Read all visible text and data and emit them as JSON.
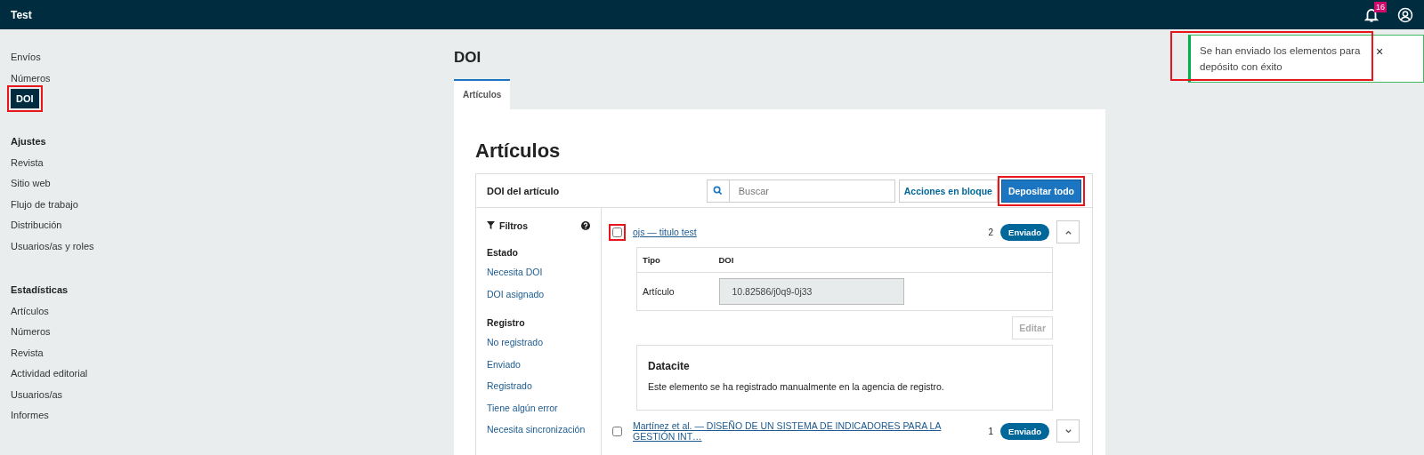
{
  "header": {
    "title": "Test",
    "notifications": "16"
  },
  "toast": {
    "message": "Se han enviado los elementos para depósito con éxito",
    "close": "×",
    "highlighted": true
  },
  "sidebar": {
    "groups": [
      {
        "items": [
          {
            "label": "Envíos",
            "selected": false,
            "highlighted": false
          },
          {
            "label": "Números",
            "selected": false,
            "highlighted": false
          },
          {
            "label": "DOI",
            "selected": true,
            "highlighted": true
          }
        ]
      },
      {
        "heading": "Ajustes",
        "items": [
          {
            "label": "Revista",
            "selected": false,
            "highlighted": false
          },
          {
            "label": "Sitio web",
            "selected": false,
            "highlighted": false
          },
          {
            "label": "Flujo de trabajo",
            "selected": false,
            "highlighted": false
          },
          {
            "label": "Distribución",
            "selected": false,
            "highlighted": false
          },
          {
            "label": "Usuarios/as y roles",
            "selected": false,
            "highlighted": false
          }
        ]
      },
      {
        "heading": "Estadísticas",
        "items": [
          {
            "label": "Artículos",
            "selected": false,
            "highlighted": false
          },
          {
            "label": "Números",
            "selected": false,
            "highlighted": false
          },
          {
            "label": "Revista",
            "selected": false,
            "highlighted": false
          },
          {
            "label": "Actividad editorial",
            "selected": false,
            "highlighted": false
          },
          {
            "label": "Usuarios/as",
            "selected": false,
            "highlighted": false
          },
          {
            "label": "Informes",
            "selected": false,
            "highlighted": false
          }
        ]
      }
    ]
  },
  "page_title": "DOI",
  "tabs": [
    {
      "label": "Artículos",
      "selected": true
    }
  ],
  "section_title": "Artículos",
  "card": {
    "title": "DOI del artículo",
    "search": {
      "placeholder": "Buscar"
    },
    "bulk_button": "Acciones en bloque",
    "deposit_button": {
      "label": "Depositar todo",
      "highlighted": true
    }
  },
  "filters": {
    "title": "Filtros",
    "groups": [
      {
        "heading": "Estado",
        "items": [
          "Necesita DOI",
          "DOI asignado"
        ]
      },
      {
        "heading": "Registro",
        "items": [
          "No registrado",
          "Enviado",
          "Registrado",
          "Tiene algún error",
          "Necesita sincronización"
        ]
      }
    ]
  },
  "items": [
    {
      "title": "ojs — titulo test",
      "checked": false,
      "highlighted": true,
      "count": "2",
      "status": "Enviado",
      "expanded": true,
      "details": {
        "columns": [
          "Tipo",
          "DOI"
        ],
        "rows": [
          {
            "type": "Artículo",
            "doi": "10.82586/j0q9-0j33"
          }
        ],
        "edit": "Editar",
        "agency": {
          "title": "Datacite",
          "message": "Este elemento se ha registrado manualmente en la agencia de registro."
        }
      }
    },
    {
      "title": "Martínez et al. — DISEÑO DE UN SISTEMA DE INDICADORES PARA LA GESTIÓN INT…",
      "checked": false,
      "count": "1",
      "status": "Enviado",
      "expanded": false
    }
  ]
}
